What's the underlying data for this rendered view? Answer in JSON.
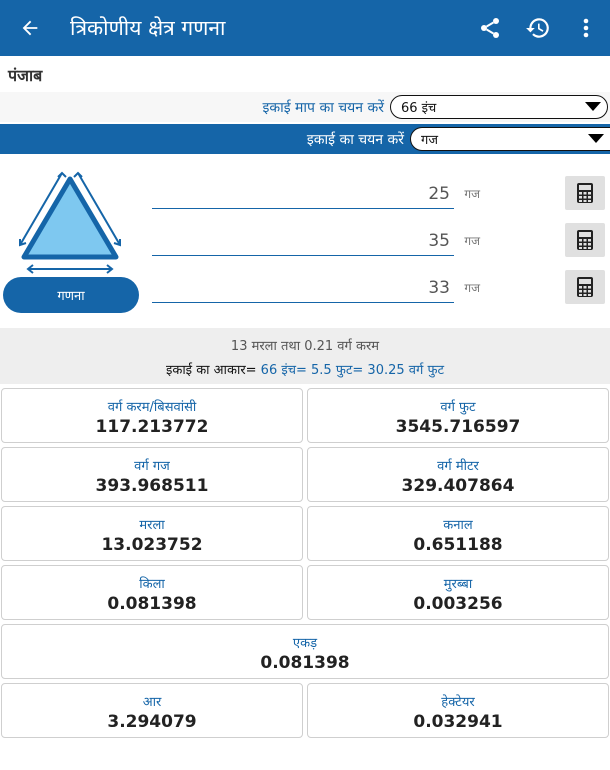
{
  "appbar": {
    "title": "त्रिकोणीय क्षेत्र गणना",
    "back_icon": "arrow-back-icon",
    "share_icon": "share-icon",
    "history_icon": "history-icon",
    "menu_icon": "more-vert-icon"
  },
  "state_name": "पंजाब",
  "unit_measure": {
    "label": "इकाई माप का चयन करें",
    "selected": "66 इंच"
  },
  "unit_select": {
    "label": "इकाई का चयन करें",
    "selected": "गज"
  },
  "sides": [
    {
      "value": "25",
      "unit": "गज"
    },
    {
      "value": "35",
      "unit": "गज"
    },
    {
      "value": "33",
      "unit": "गज"
    }
  ],
  "calculate_button": "गणना",
  "summary": {
    "line1": "13 मरला तथा 0.21 वर्ग करम",
    "line2_prefix": "इकाई का आकार=",
    "line2_rest": " 66 इंच= 5.5 फुट= 30.25 वर्ग फुट"
  },
  "results": [
    {
      "name": "वर्ग करम/बिसवांसी",
      "value": "117.213772"
    },
    {
      "name": "वर्ग फुट",
      "value": "3545.716597"
    },
    {
      "name": "वर्ग गज",
      "value": "393.968511"
    },
    {
      "name": "वर्ग मीटर",
      "value": "329.407864"
    },
    {
      "name": "मरला",
      "value": "13.023752"
    },
    {
      "name": "कनाल",
      "value": "0.651188"
    },
    {
      "name": "किला",
      "value": "0.081398"
    },
    {
      "name": "मुरब्बा",
      "value": "0.003256"
    },
    {
      "name": "एकड़",
      "value": "0.081398"
    },
    {
      "name": "आर",
      "value": "3.294079"
    },
    {
      "name": "हेक्टेयर",
      "value": "0.032941"
    }
  ],
  "colors": {
    "primary": "#1565a8",
    "triangle_fill": "#7ec8f0"
  }
}
